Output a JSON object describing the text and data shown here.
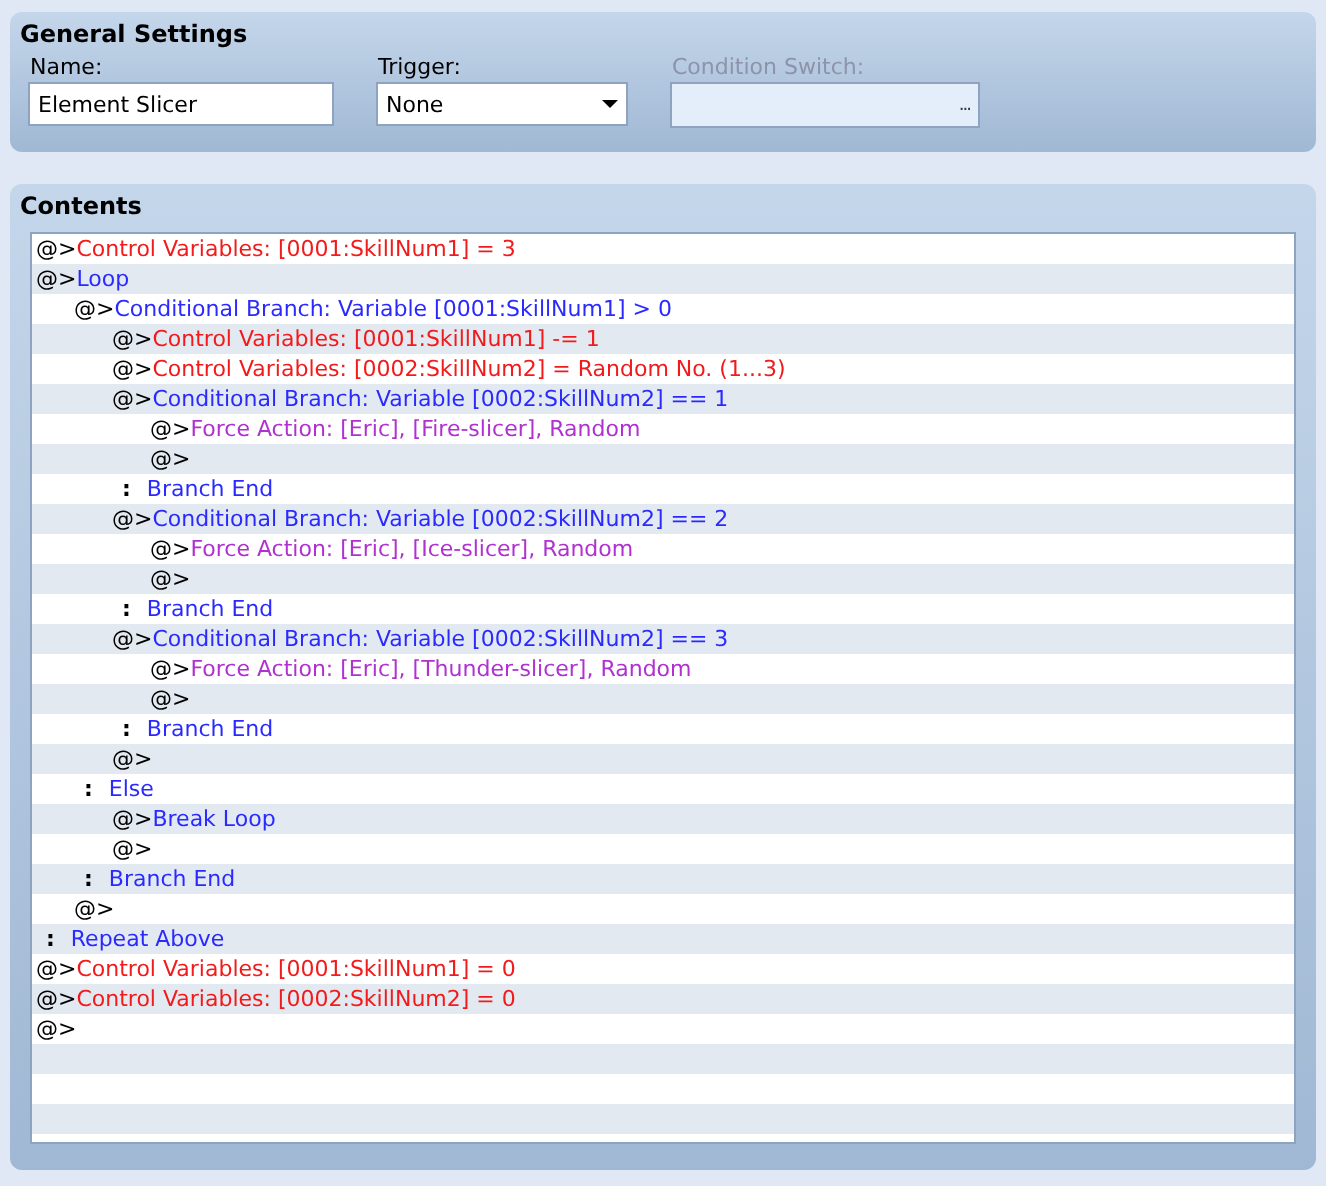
{
  "general_settings": {
    "title": "General Settings",
    "name_field": {
      "label": "Name:",
      "value": "Element Slicer"
    },
    "trigger": {
      "label": "Trigger:",
      "value": "None"
    },
    "condition_switch": {
      "label": "Condition Switch:",
      "disabled": true,
      "button_label": "..."
    }
  },
  "contents": {
    "title": "Contents",
    "lines": [
      {
        "marker": "@>",
        "kind": "variable",
        "text": "Control Variables: [0001:SkillNum1] = 3"
      },
      {
        "marker": "@>",
        "kind": "flow",
        "text": "Loop",
        "children": [
          {
            "marker": "@>",
            "kind": "flow",
            "text": "Conditional Branch: Variable [0001:SkillNum1] > 0",
            "children": [
              {
                "marker": "@>",
                "kind": "variable",
                "text": "Control Variables: [0001:SkillNum1] -= 1"
              },
              {
                "marker": "@>",
                "kind": "variable",
                "text": "Control Variables: [0002:SkillNum2] = Random No. (1...3)"
              },
              {
                "marker": "@>",
                "kind": "flow",
                "text": "Conditional Branch: Variable [0002:SkillNum2] == 1",
                "children": [
                  {
                    "marker": "@>",
                    "kind": "action",
                    "text": "Force Action: [Eric], [Fire-slicer], Random"
                  },
                  {
                    "marker": "@>",
                    "kind": "empty"
                  }
                ]
              },
              {
                "marker": ":",
                "kind": "flow",
                "text": "Branch End"
              },
              {
                "marker": "@>",
                "kind": "flow",
                "text": "Conditional Branch: Variable [0002:SkillNum2] == 2",
                "children": [
                  {
                    "marker": "@>",
                    "kind": "action",
                    "text": "Force Action: [Eric], [Ice-slicer], Random"
                  },
                  {
                    "marker": "@>",
                    "kind": "empty"
                  }
                ]
              },
              {
                "marker": ":",
                "kind": "flow",
                "text": "Branch End"
              },
              {
                "marker": "@>",
                "kind": "flow",
                "text": "Conditional Branch: Variable [0002:SkillNum2] == 3",
                "children": [
                  {
                    "marker": "@>",
                    "kind": "action",
                    "text": "Force Action: [Eric], [Thunder-slicer], Random"
                  },
                  {
                    "marker": "@>",
                    "kind": "empty"
                  }
                ]
              },
              {
                "marker": ":",
                "kind": "flow",
                "text": "Branch End"
              },
              {
                "marker": "@>",
                "kind": "empty"
              }
            ]
          },
          {
            "marker": ":",
            "kind": "flow",
            "text": "Else",
            "children": [
              {
                "marker": "@>",
                "kind": "flow",
                "text": "Break Loop"
              },
              {
                "marker": "@>",
                "kind": "empty"
              }
            ]
          },
          {
            "marker": ":",
            "kind": "flow",
            "text": "Branch End"
          },
          {
            "marker": "@>",
            "kind": "empty"
          }
        ]
      },
      {
        "marker": ":",
        "kind": "flow",
        "text": "Repeat Above"
      },
      {
        "marker": "@>",
        "kind": "variable",
        "text": "Control Variables: [0001:SkillNum1] = 0"
      },
      {
        "marker": "@>",
        "kind": "variable",
        "text": "Control Variables: [0002:SkillNum2] = 0"
      },
      {
        "marker": "@>",
        "kind": "empty"
      }
    ]
  }
}
